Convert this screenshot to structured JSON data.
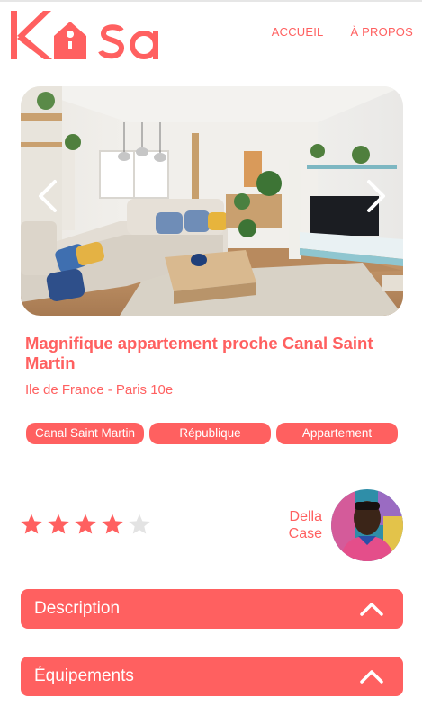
{
  "colors": {
    "accent": "#FF6060",
    "star_empty": "#E3E3E3",
    "text_on_accent": "#FFFFFF"
  },
  "logo": {
    "text": "Kasa"
  },
  "nav": {
    "home": "ACCUEIL",
    "about": "À PROPOS"
  },
  "listing": {
    "title": "Magnifique appartement proche Canal Saint Martin",
    "location": "Ile de France - Paris 10e",
    "tags": [
      "Canal Saint Martin",
      "République",
      "Appartement"
    ],
    "rating": 4,
    "rating_max": 5,
    "host": {
      "first_name": "Della",
      "last_name": "Case"
    }
  },
  "carousel": {
    "prev_icon": "chevron-left-icon",
    "next_icon": "chevron-right-icon"
  },
  "collapses": [
    {
      "label": "Description",
      "icon": "chevron-up-icon"
    },
    {
      "label": "Équipements",
      "icon": "chevron-up-icon"
    }
  ]
}
